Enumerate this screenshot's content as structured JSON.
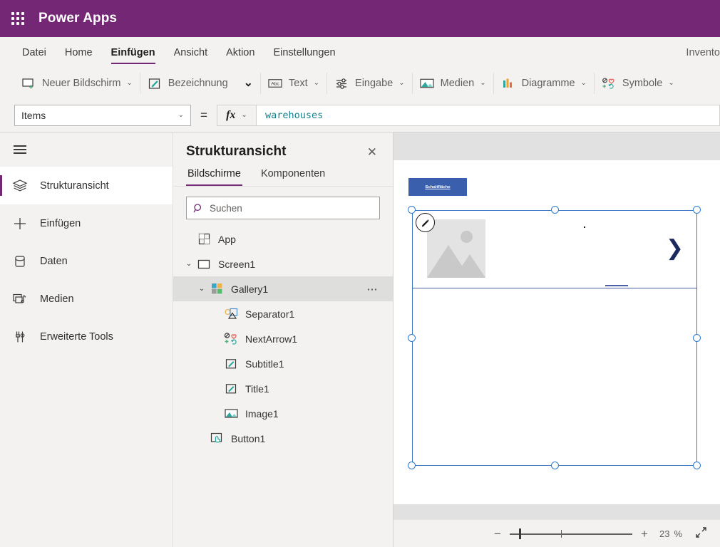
{
  "topbar": {
    "waffle_icon": "grid-waffle-icon",
    "brand": "Power Apps"
  },
  "menubar": {
    "items": [
      {
        "label": "Datei",
        "active": false
      },
      {
        "label": "Home",
        "active": false
      },
      {
        "label": "Einfügen",
        "active": true
      },
      {
        "label": "Ansicht",
        "active": false
      },
      {
        "label": "Aktion",
        "active": false
      },
      {
        "label": "Einstellungen",
        "active": false
      }
    ],
    "app_name": "Invento"
  },
  "ribbon": {
    "groups": [
      {
        "label": "Neuer Bildschirm",
        "icon": "new-screen-icon",
        "caret": "⌄"
      },
      {
        "label": "Bezeichnung",
        "icon": "label-pencil-icon",
        "caret": "⌄"
      },
      {
        "label": "Text",
        "icon": "abc-text-icon",
        "caret": "⌄"
      },
      {
        "label": "Eingabe",
        "icon": "input-sliders-icon",
        "caret": "⌄"
      },
      {
        "label": "Medien",
        "icon": "media-image-icon",
        "caret": "⌄"
      },
      {
        "label": "Diagramme",
        "icon": "charts-bar-icon",
        "caret": "⌄"
      },
      {
        "label": "Symbole",
        "icon": "icons-shapes-icon",
        "caret": "⌄"
      }
    ]
  },
  "formulabar": {
    "property": "Items",
    "property_caret": "⌄",
    "equals": "=",
    "fx_label": "fx",
    "fx_caret": "⌄",
    "formula": "warehouses"
  },
  "rail": {
    "hamburger_icon": "hamburger-menu-icon",
    "items": [
      {
        "label": "Strukturansicht",
        "icon": "layers-icon",
        "selected": true
      },
      {
        "label": "Einfügen",
        "icon": "plus-icon",
        "selected": false
      },
      {
        "label": "Daten",
        "icon": "database-icon",
        "selected": false
      },
      {
        "label": "Medien",
        "icon": "media-icon",
        "selected": false
      },
      {
        "label": "Erweiterte Tools",
        "icon": "tools-icon",
        "selected": false
      }
    ]
  },
  "treepanel": {
    "title": "Strukturansicht",
    "close_icon": "close-icon",
    "tabs": [
      {
        "label": "Bildschirme",
        "active": true
      },
      {
        "label": "Komponenten",
        "active": false
      }
    ],
    "search": {
      "placeholder": "Suchen",
      "value": "",
      "icon": "search-icon"
    },
    "nodes": [
      {
        "label": "App",
        "depth": 0,
        "icon": "app-icon",
        "twisty": "",
        "selected": false,
        "menu": ""
      },
      {
        "label": "Screen1",
        "depth": 0,
        "icon": "screen-icon",
        "twisty": "⌄",
        "selected": false,
        "menu": ""
      },
      {
        "label": "Gallery1",
        "depth": 1,
        "icon": "gallery-icon",
        "twisty": "⌄",
        "selected": true,
        "menu": "⋯"
      },
      {
        "label": "Separator1",
        "depth": 2,
        "icon": "separator-icon",
        "twisty": "",
        "selected": false,
        "menu": ""
      },
      {
        "label": "NextArrow1",
        "depth": 2,
        "icon": "nextarrow-icon",
        "twisty": "",
        "selected": false,
        "menu": ""
      },
      {
        "label": "Subtitle1",
        "depth": 2,
        "icon": "label-icon",
        "twisty": "",
        "selected": false,
        "menu": ""
      },
      {
        "label": "Title1",
        "depth": 2,
        "icon": "label-icon",
        "twisty": "",
        "selected": false,
        "menu": ""
      },
      {
        "label": "Image1",
        "depth": 2,
        "icon": "image-icon",
        "twisty": "",
        "selected": false,
        "menu": ""
      },
      {
        "label": "Button1",
        "depth": 1,
        "icon": "button-icon",
        "twisty": "",
        "selected": false,
        "menu": ""
      }
    ]
  },
  "canvas": {
    "button_label": "Schaltfläche",
    "edit_badge_icon": "pencil-edit-icon",
    "next_arrow_icon": "chevron-right-icon",
    "image_placeholder_icon": "image-placeholder-icon",
    "selection_color": "#2f7ad0",
    "button_color": "#3a5fad"
  },
  "statusbar": {
    "zoom_out_icon": "minus-icon",
    "zoom_in_icon": "plus-icon",
    "zoom_value": "23",
    "zoom_unit": "%",
    "fit_icon": "fit-screen-icon"
  }
}
